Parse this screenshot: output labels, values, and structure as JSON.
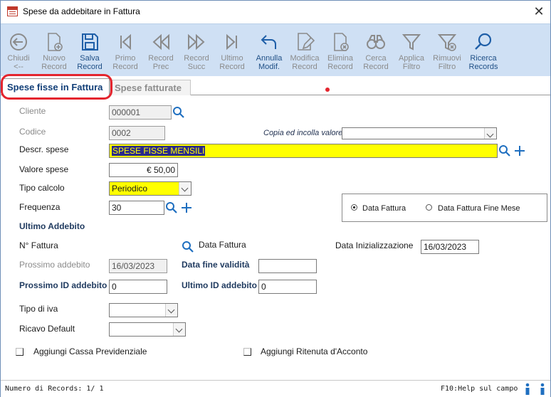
{
  "window": {
    "title": "Spese da addebitare in Fattura",
    "close": "✕"
  },
  "toolbar": [
    {
      "id": "chiudi",
      "label": "Chiudi\n<--",
      "enabled": false,
      "icon": "back-circle-icon"
    },
    {
      "id": "nuovo",
      "label": "Nuovo\nRecord",
      "enabled": false,
      "icon": "new-document-icon"
    },
    {
      "id": "salva",
      "label": "Salva\nRecord",
      "enabled": true,
      "icon": "save-floppy-icon"
    },
    {
      "id": "primo",
      "label": "Primo\nRecord",
      "enabled": false,
      "icon": "first-record-icon"
    },
    {
      "id": "prec",
      "label": "Record\nPrec",
      "enabled": false,
      "icon": "previous-record-icon"
    },
    {
      "id": "succ",
      "label": "Record\nSucc",
      "enabled": false,
      "icon": "next-record-icon"
    },
    {
      "id": "ultimo",
      "label": "Ultimo\nRecord",
      "enabled": false,
      "icon": "last-record-icon"
    },
    {
      "id": "annulla",
      "label": "Annulla\nModif.",
      "enabled": true,
      "icon": "undo-arrow-icon"
    },
    {
      "id": "modifica",
      "label": "Modifica\nRecord",
      "enabled": false,
      "icon": "edit-document-icon"
    },
    {
      "id": "elimina",
      "label": "Elimina\nRecord",
      "enabled": false,
      "icon": "delete-document-icon"
    },
    {
      "id": "cerca",
      "label": "Cerca\nRecord",
      "enabled": false,
      "icon": "binoculars-icon"
    },
    {
      "id": "applica",
      "label": "Applica\nFiltro",
      "enabled": false,
      "icon": "filter-icon"
    },
    {
      "id": "rimuovi",
      "label": "Rimuovi\nFiltro",
      "enabled": false,
      "icon": "remove-filter-icon"
    },
    {
      "id": "ricerca",
      "label": "Ricerca\nRecords",
      "enabled": true,
      "icon": "search-icon"
    }
  ],
  "tabs": {
    "active": "Spese fisse in Fattura",
    "inactive": "Spese fatturate"
  },
  "form": {
    "cliente": {
      "label": "Cliente",
      "value": "000001"
    },
    "codice": {
      "label": "Codice",
      "value": "0002"
    },
    "copia": {
      "label": "Copia ed incolla valore",
      "value": ""
    },
    "descr": {
      "label": "Descr. spese",
      "value": "SPESE FISSE MENSILI"
    },
    "valore": {
      "label": "Valore spese",
      "value": "€ 50,00"
    },
    "tipo_calcolo": {
      "label": "Tipo calcolo",
      "value": "Periodico"
    },
    "frequenza": {
      "label": "Frequenza",
      "value": "30"
    },
    "ultimo_addebito": {
      "label": "Ultimo Addebito"
    },
    "n_fattura": {
      "label": "N° Fattura"
    },
    "data_fattura": {
      "label": "Data Fattura"
    },
    "data_iniz": {
      "label": "Data Inizializzazione",
      "value": "16/03/2023"
    },
    "prossimo": {
      "label": "Prossimo addebito",
      "value": "16/03/2023"
    },
    "data_fine": {
      "label": "Data fine validità",
      "value": ""
    },
    "prossimo_id": {
      "label": "Prossimo ID addebito",
      "value": "0"
    },
    "ultimo_id": {
      "label": "Ultimo ID addebito",
      "value": "0"
    },
    "tipo_iva": {
      "label": "Tipo di iva",
      "value": ""
    },
    "ricavo": {
      "label": "Ricavo Default",
      "value": ""
    },
    "radio_data_fattura": {
      "label": "Data Fattura",
      "selected": true
    },
    "radio_fine_mese": {
      "label": "Data Fattura Fine Mese",
      "selected": false
    },
    "cassa": {
      "label": "Aggiungi Cassa Previdenziale",
      "checked": false
    },
    "ritenuta": {
      "label": "Aggiungi Ritenuta d'Acconto",
      "checked": false
    }
  },
  "status": {
    "records": "Numero di Records: 1/ 1",
    "help": "F10:Help sul campo"
  },
  "colors": {
    "accent": "#1f4f86",
    "toolbar_bg": "#cfe0f4",
    "highlight": "#e4252e",
    "yellow": "#ffff00"
  }
}
